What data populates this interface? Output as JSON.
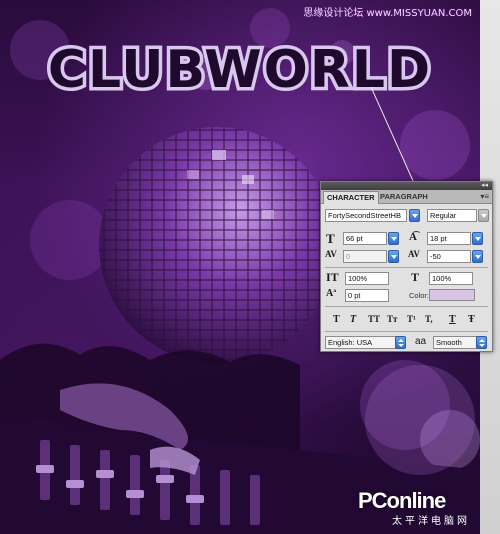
{
  "artwork": {
    "headline": "CLUBWORLD",
    "watermark_top": "思缘设计论坛 www.MISSYUAN.COM",
    "watermark_brand": "PConline",
    "watermark_sub": "太平洋电脑网"
  },
  "colors": {
    "art_purple": "#3b1255",
    "headline_fill": "#d9c8ee",
    "swatch": "#d8c4e4",
    "accent_blue": "#2d6ecf"
  },
  "panel": {
    "tabs": [
      "CHARACTER",
      "PARAGRAPH"
    ],
    "active_tab": "CHARACTER",
    "font_family": "FortySecondStreetHB",
    "font_style": "Regular",
    "font_size": "66 pt",
    "leading": "18 pt",
    "kerning": "0",
    "tracking": "-50",
    "vertical_scale": "100%",
    "horizontal_scale": "100%",
    "baseline_shift": "0 pt",
    "color_label": "Color:",
    "language": "English: USA",
    "antialias_icon": "aa",
    "antialias": "Smooth",
    "style_buttons": [
      "T",
      "T",
      "TT",
      "Tт",
      "T¹",
      "T,",
      "T",
      "Ŧ"
    ],
    "icons": {
      "size": "font-size-icon",
      "leading": "leading-icon",
      "kerning": "kerning-icon",
      "tracking": "tracking-icon",
      "vscale": "vertical-scale-icon",
      "hscale": "horizontal-scale-icon",
      "baseline": "baseline-shift-icon"
    }
  }
}
